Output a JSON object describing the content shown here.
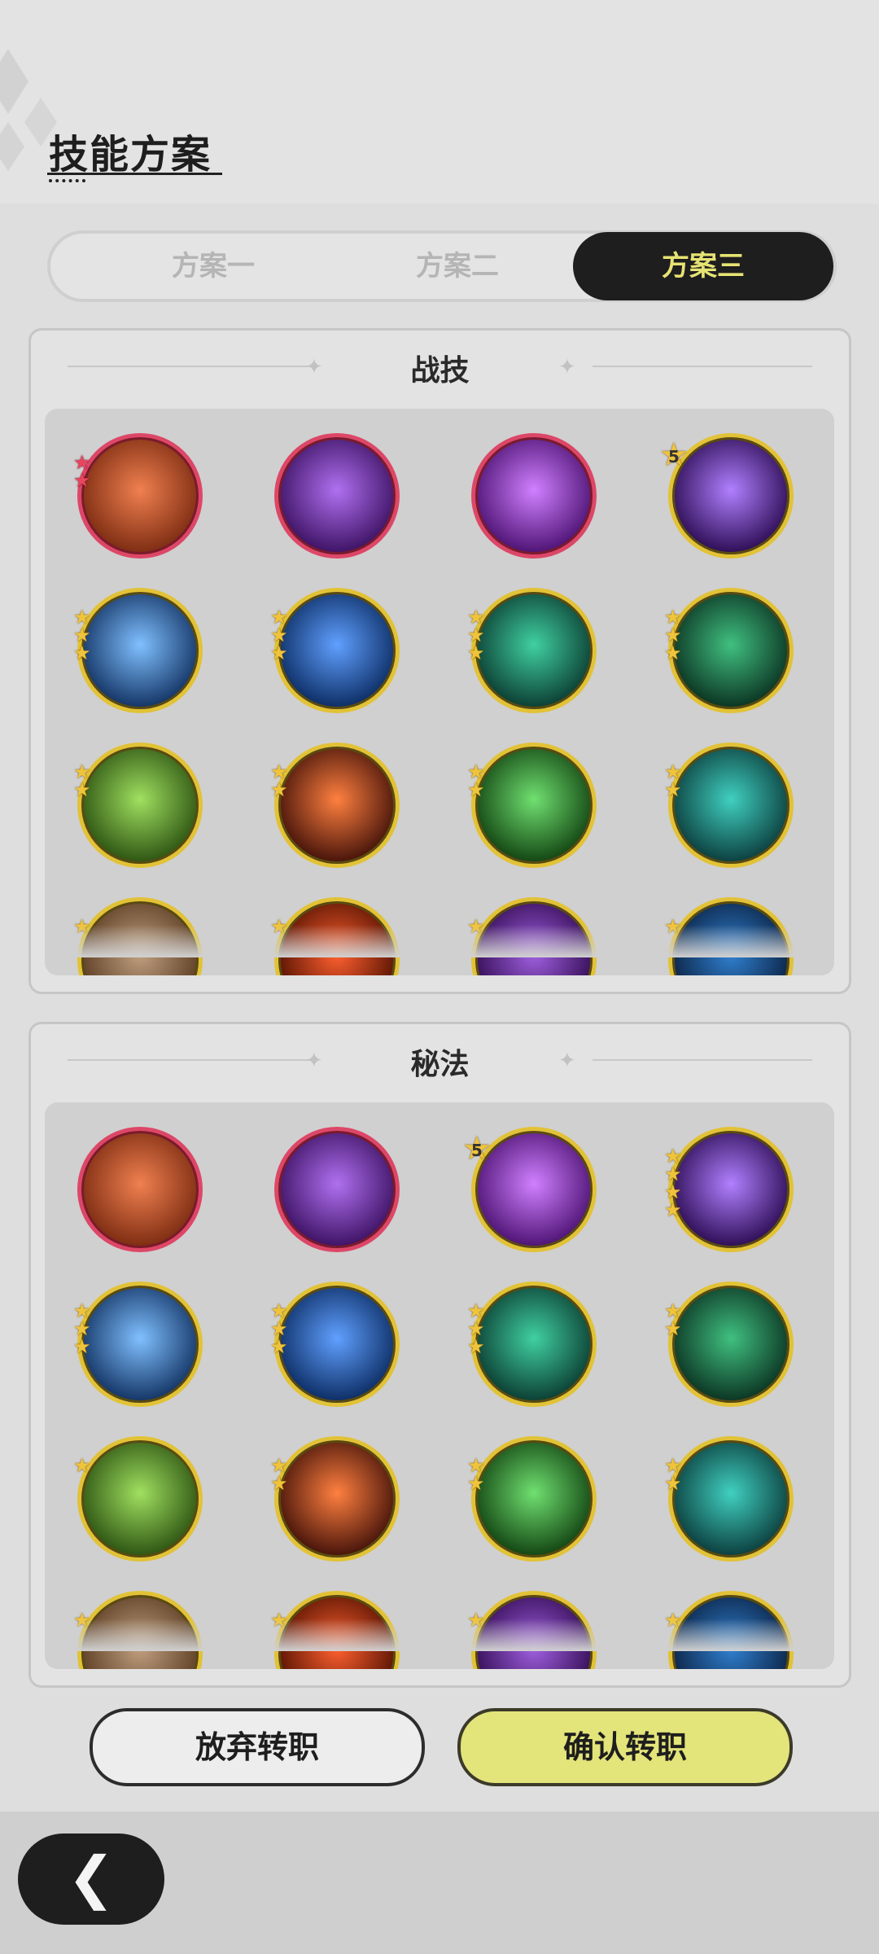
{
  "header": {
    "title": "技能方案"
  },
  "tabs": [
    {
      "label": "方案一",
      "active": false
    },
    {
      "label": "方案二",
      "active": false
    },
    {
      "label": "方案三",
      "active": true
    }
  ],
  "sections": [
    {
      "title": "战技",
      "skills": [
        {
          "name": "earth-shield-skill-icon",
          "frame": "red",
          "stars": 2
        },
        {
          "name": "purple-star-burst-skill-icon",
          "frame": "red",
          "stars": 0
        },
        {
          "name": "violet-shatter-skill-icon",
          "frame": "red",
          "stars": 0
        },
        {
          "name": "shadow-hand-skill-icon",
          "frame": "gold",
          "stars": 5
        },
        {
          "name": "ice-burst-skill-icon",
          "frame": "gold",
          "stars": 3
        },
        {
          "name": "frost-creature-skill-icon",
          "frame": "gold",
          "stars": 3
        },
        {
          "name": "wind-slash-skill-icon",
          "frame": "gold",
          "stars": 3
        },
        {
          "name": "heal-cross-skill-icon",
          "frame": "gold",
          "stars": 3
        },
        {
          "name": "tree-stump-skill-icon",
          "frame": "gold",
          "stars": 2
        },
        {
          "name": "fire-swirl-skill-icon",
          "frame": "gold",
          "stars": 2
        },
        {
          "name": "green-flame-skill-icon",
          "frame": "gold",
          "stars": 2
        },
        {
          "name": "wind-vortex-skill-icon",
          "frame": "gold",
          "stars": 2
        },
        {
          "name": "rock-skill-icon",
          "frame": "gold",
          "stars": 1
        },
        {
          "name": "flame-skill-icon",
          "frame": "gold",
          "stars": 1
        },
        {
          "name": "purple-rune-skill-icon",
          "frame": "gold",
          "stars": 1
        },
        {
          "name": "water-skill-icon",
          "frame": "gold",
          "stars": 1
        }
      ]
    },
    {
      "title": "秘法",
      "skills": [
        {
          "name": "heart-mage-skill-icon",
          "frame": "red",
          "stars": 0
        },
        {
          "name": "fire-shards-skill-icon",
          "frame": "red",
          "stars": 0
        },
        {
          "name": "power-up-skill-icon",
          "frame": "gold",
          "stars": 5
        },
        {
          "name": "hooded-figure-skill-icon",
          "frame": "gold",
          "stars": 4
        },
        {
          "name": "violet-orb-skill-icon",
          "frame": "gold",
          "stars": 3
        },
        {
          "name": "holy-arrow-skill-icon",
          "frame": "gold",
          "stars": 3
        },
        {
          "name": "sparkle-arrow-skill-icon",
          "frame": "gold",
          "stars": 3
        },
        {
          "name": "crystal-skill-icon",
          "frame": "gold",
          "stars": 2
        },
        {
          "name": "green-heart-skill-icon",
          "frame": "gold",
          "stars": 1
        },
        {
          "name": "golden-claw-skill-icon",
          "frame": "gold",
          "stars": 2
        },
        {
          "name": "purple-eye-skill-icon",
          "frame": "gold",
          "stars": 2
        },
        {
          "name": "green-star-skill-icon",
          "frame": "gold",
          "stars": 2
        },
        {
          "name": "violet-lock-skill-icon",
          "frame": "gold",
          "stars": 1
        },
        {
          "name": "armor-skill-icon",
          "frame": "gold",
          "stars": 1
        },
        {
          "name": "green-burst-skill-icon",
          "frame": "gold",
          "stars": 1
        },
        {
          "name": "teal-spirit-skill-icon",
          "frame": "gold",
          "stars": 1
        }
      ]
    }
  ],
  "buttons": {
    "cancel": "放弃转职",
    "confirm": "确认转职"
  },
  "back": {
    "icon": "chevron-left-icon",
    "glyph": "❮"
  },
  "colors": {
    "accent": "#e3e47a",
    "dark": "#1e1e1e",
    "red_frame": "#dd4767",
    "gold_frame": "#e2c236"
  }
}
